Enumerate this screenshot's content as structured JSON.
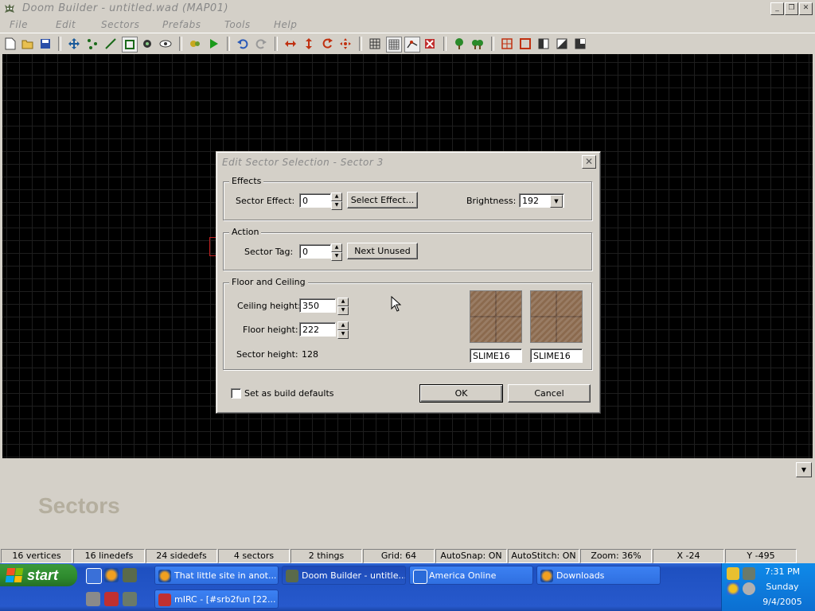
{
  "window": {
    "title": "Doom Builder - untitled.wad (MAP01)"
  },
  "menu": [
    "File",
    "Edit",
    "Sectors",
    "Prefabs",
    "Tools",
    "Help"
  ],
  "mode_label": "Sectors",
  "dialog": {
    "title": "Edit Sector Selection - Sector 3",
    "close_label": "✕",
    "effects": {
      "group_label": "Effects",
      "sector_effect_label": "Sector Effect:",
      "sector_effect_value": "0",
      "select_effect_label": "Select Effect...",
      "brightness_label": "Brightness:",
      "brightness_value": "192"
    },
    "action": {
      "group_label": "Action",
      "sector_tag_label": "Sector Tag:",
      "sector_tag_value": "0",
      "next_unused_label": "Next Unused"
    },
    "floor_ceiling": {
      "group_label": "Floor and Ceiling",
      "ceiling_height_label": "Ceiling height:",
      "ceiling_height_value": "350",
      "floor_height_label": "Floor height:",
      "floor_height_value": "222",
      "sector_height_label": "Sector height:",
      "sector_height_value": "128",
      "ceiling_texture": "SLIME16",
      "floor_texture": "SLIME16"
    },
    "build_defaults_label": "Set as build defaults",
    "ok_label": "OK",
    "cancel_label": "Cancel"
  },
  "statusbar": [
    "16 vertices",
    "16 linedefs",
    "24 sidedefs",
    "4 sectors",
    "2 things",
    "Grid: 64",
    "AutoSnap: ON",
    "AutoStitch: ON",
    "Zoom: 36%",
    "X -24",
    "Y -495"
  ],
  "taskbar": {
    "start_label": "start",
    "tasks_row1": [
      "That little site in anot...",
      "Doom Builder - untitle...",
      "America  Online",
      "Downloads"
    ],
    "tasks_row2": [
      "mIRC - [#srb2fun [22..."
    ],
    "clock_time": "7:31 PM",
    "clock_day": "Sunday",
    "clock_date": "9/4/2005"
  }
}
